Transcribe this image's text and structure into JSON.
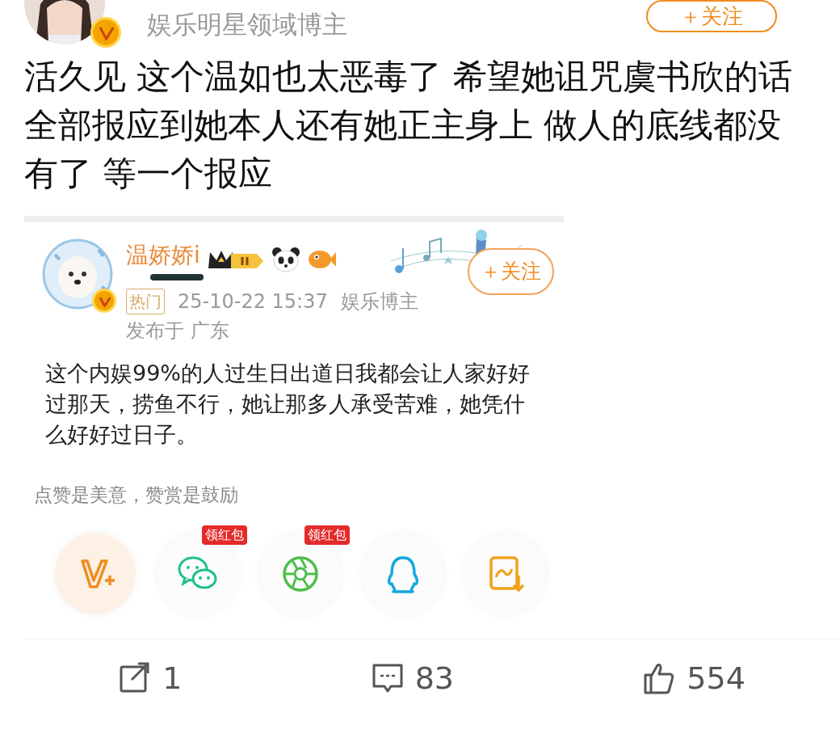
{
  "author": {
    "verified": true,
    "subtitle": "娱乐明星领域博主",
    "follow_button": "＋关注"
  },
  "post_text": "活久见 这个温如也太恶毒了 希望她诅咒虞书欣的话全部报应到她本人还有她正主身上 做人的底线都没有了 等一个报应",
  "quoted": {
    "name": "温娇娇i",
    "name_redacted": true,
    "verified": true,
    "follow_button": "＋关注",
    "tag": "热门",
    "time": "25-10-22 15:37",
    "source": "娱乐博主",
    "location": "发布于 广东",
    "text": "这个内娱99%的人过生日出道日我都会让人家好好过那天，捞鱼不行，她让那多人承受苦难，她凭什么好好过日子。"
  },
  "reward_hint": "点赞是美意，赞赏是鼓励",
  "share_buttons": [
    {
      "kind": "vplus",
      "color": "#f08c1e",
      "selected": true
    },
    {
      "kind": "wechat",
      "color": "#1fbf8f",
      "badge_text": "领红包",
      "selected": false
    },
    {
      "kind": "moments",
      "color": "#4cbf4a",
      "badge_text": "领红包",
      "selected": false
    },
    {
      "kind": "qq",
      "color": "#12a8e0",
      "selected": false
    },
    {
      "kind": "save",
      "color": "#f2a11a",
      "selected": false
    }
  ],
  "actions": [
    {
      "kind": "repost",
      "count": "1"
    },
    {
      "kind": "comment",
      "count": "83"
    },
    {
      "kind": "like",
      "count": "554"
    }
  ]
}
